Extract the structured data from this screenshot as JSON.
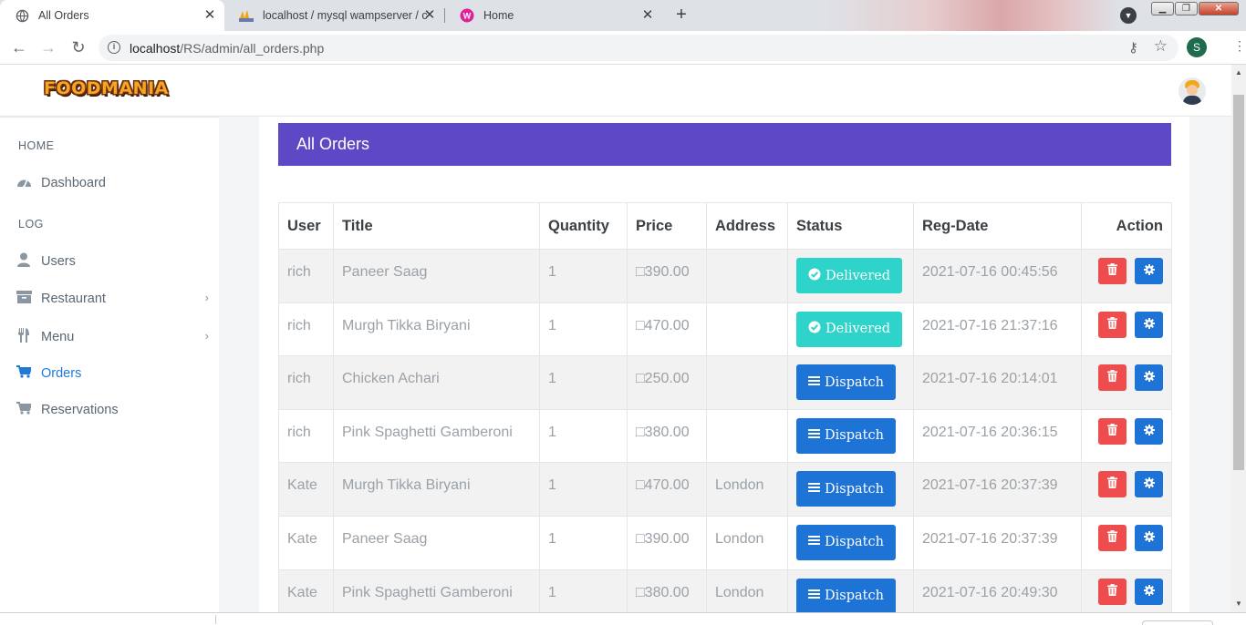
{
  "browser": {
    "tabs": [
      {
        "title": "All Orders",
        "active": true,
        "icon": "globe-icon"
      },
      {
        "title": "localhost / mysql wampserver / c",
        "active": false,
        "icon": "phpmyadmin-icon"
      },
      {
        "title": "Home",
        "active": false,
        "icon": "wamp-icon"
      }
    ],
    "url_host": "localhost",
    "url_path": "/RS/admin/all_orders.php",
    "profile_initial": "S"
  },
  "app": {
    "logo_text": "FOODMANIA",
    "page_title": "All Orders"
  },
  "sidebar": {
    "sections": [
      {
        "heading": "HOME",
        "items": [
          {
            "label": "Dashboard",
            "icon": "dashboard-icon"
          }
        ]
      },
      {
        "heading": "LOG",
        "items": [
          {
            "label": "Users",
            "icon": "user-icon"
          },
          {
            "label": "Restaurant",
            "icon": "archive-icon",
            "has_submenu": true
          },
          {
            "label": "Menu",
            "icon": "cutlery-icon",
            "has_submenu": true
          },
          {
            "label": "Orders",
            "icon": "cart-icon",
            "active": true
          },
          {
            "label": "Reservations",
            "icon": "cart-icon"
          }
        ]
      }
    ]
  },
  "table": {
    "columns": [
      "User",
      "Title",
      "Quantity",
      "Price",
      "Address",
      "Status",
      "Reg-Date",
      "Action"
    ],
    "rows": [
      {
        "user": "rich",
        "title": "Paneer Saag",
        "quantity": "1",
        "price": "□390.00",
        "address": "",
        "status": "Delivered",
        "reg_date": "2021-07-16 00:45:56"
      },
      {
        "user": "rich",
        "title": "Murgh Tikka Biryani",
        "quantity": "1",
        "price": "□470.00",
        "address": "",
        "status": "Delivered",
        "reg_date": "2021-07-16 21:37:16"
      },
      {
        "user": "rich",
        "title": "Chicken Achari",
        "quantity": "1",
        "price": "□250.00",
        "address": "",
        "status": "Dispatch",
        "reg_date": "2021-07-16 20:14:01"
      },
      {
        "user": "rich",
        "title": "Pink Spaghetti Gamberoni",
        "quantity": "1",
        "price": "□380.00",
        "address": "",
        "status": "Dispatch",
        "reg_date": "2021-07-16 20:36:15"
      },
      {
        "user": "Kate",
        "title": "Murgh Tikka Biryani",
        "quantity": "1",
        "price": "□470.00",
        "address": "London",
        "status": "Dispatch",
        "reg_date": "2021-07-16 20:37:39"
      },
      {
        "user": "Kate",
        "title": "Paneer Saag",
        "quantity": "1",
        "price": "□390.00",
        "address": "London",
        "status": "Dispatch",
        "reg_date": "2021-07-16 20:37:39"
      },
      {
        "user": "Kate",
        "title": "Pink Spaghetti Gamberoni",
        "quantity": "1",
        "price": "□380.00",
        "address": "London",
        "status": "Dispatch",
        "reg_date": "2021-07-16 20:49:30"
      }
    ]
  },
  "colors": {
    "header_bg": "#5f48c6",
    "delivered": "#2ed3ca",
    "dispatch": "#1e73d6",
    "delete": "#ef4d4d",
    "active_nav": "#1e7ad6"
  }
}
